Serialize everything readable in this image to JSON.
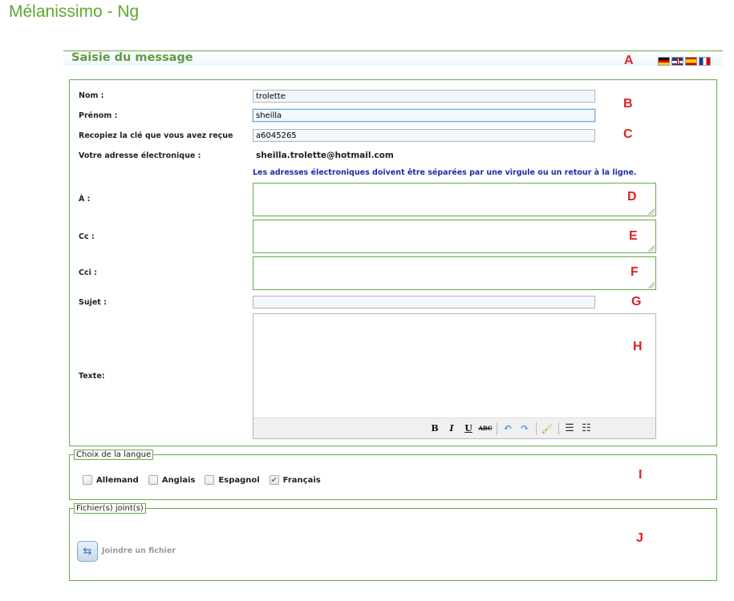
{
  "app": {
    "title": "Mélanissimo - Ng"
  },
  "section": {
    "title": "Saisie du message"
  },
  "flags": [
    "german-flag-icon",
    "uk-flag-icon",
    "spanish-flag-icon",
    "french-flag-icon"
  ],
  "form": {
    "nom_label": "Nom :",
    "nom_value": "trolette",
    "prenom_label": "Prénom :",
    "prenom_value": "sheilla",
    "cle_label": "Recopiez la clé que vous avez reçue",
    "cle_value": "a6045265",
    "email_label": "Votre adresse électronique :",
    "email_value": "sheilla.trolette@hotmail.com",
    "info": "Les adresses électroniques doivent être séparées par une virgule ou un retour à la ligne.",
    "a_label": "À :",
    "cc_label": "Cc :",
    "cci_label": "Cci :",
    "sujet_label": "Sujet :",
    "sujet_value": "",
    "texte_label": "Texte:"
  },
  "toolbar": {
    "bold": "B",
    "italic": "I",
    "underline": "U",
    "strike": "ABC",
    "undo": "↶",
    "redo": "↷",
    "clean": "🖌",
    "bullets": "☰",
    "numbers": "☷"
  },
  "langue": {
    "legend": "Choix de la langue",
    "options": [
      {
        "label": "Allemand",
        "checked": false
      },
      {
        "label": "Anglais",
        "checked": false
      },
      {
        "label": "Espagnol",
        "checked": false
      },
      {
        "label": "Français",
        "checked": true
      }
    ]
  },
  "fichiers": {
    "legend": "Fichier(s) joint(s)",
    "attach_label": "Joindre un fichier"
  },
  "markers": [
    "A",
    "B",
    "C",
    "D",
    "E",
    "F",
    "G",
    "H",
    "I",
    "J"
  ],
  "colors": {
    "accent_green": "#6aa84f",
    "title_green": "#5ea82f",
    "info_blue": "#1a2fa8",
    "marker_red": "#e02020"
  }
}
